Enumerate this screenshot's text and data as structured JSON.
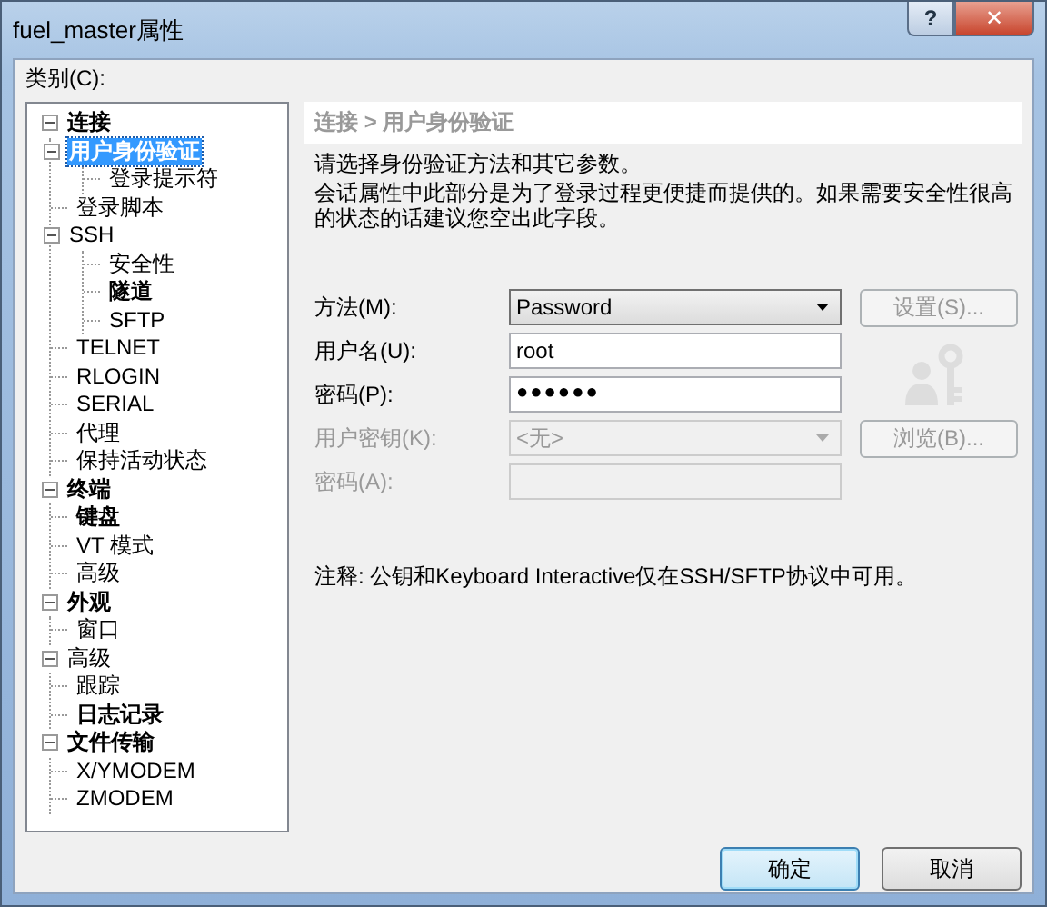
{
  "window": {
    "title": "fuel_master属性",
    "controls": [
      {
        "kind": "help",
        "label": "?"
      },
      {
        "kind": "close",
        "label": "✕"
      }
    ]
  },
  "category_label": "类别(C):",
  "tree": [
    {
      "label": "连接",
      "bold": true,
      "selected": false,
      "expanded": true,
      "children": [
        {
          "label": "用户身份验证",
          "bold": true,
          "selected": true,
          "expanded": true,
          "children": [
            {
              "label": "登录提示符",
              "bold": false,
              "selected": false
            }
          ]
        },
        {
          "label": "登录脚本",
          "bold": false,
          "selected": false
        },
        {
          "label": "SSH",
          "bold": false,
          "selected": false,
          "expanded": true,
          "children": [
            {
              "label": "安全性",
              "bold": false,
              "selected": false
            },
            {
              "label": "隧道",
              "bold": true,
              "selected": false
            },
            {
              "label": "SFTP",
              "bold": false,
              "selected": false
            }
          ]
        },
        {
          "label": "TELNET",
          "bold": false,
          "selected": false
        },
        {
          "label": "RLOGIN",
          "bold": false,
          "selected": false
        },
        {
          "label": "SERIAL",
          "bold": false,
          "selected": false
        },
        {
          "label": "代理",
          "bold": false,
          "selected": false
        },
        {
          "label": "保持活动状态",
          "bold": false,
          "selected": false
        }
      ]
    },
    {
      "label": "终端",
      "bold": true,
      "selected": false,
      "expanded": true,
      "children": [
        {
          "label": "键盘",
          "bold": true,
          "selected": false
        },
        {
          "label": "VT 模式",
          "bold": false,
          "selected": false
        },
        {
          "label": "高级",
          "bold": false,
          "selected": false
        }
      ]
    },
    {
      "label": "外观",
      "bold": true,
      "selected": false,
      "expanded": true,
      "children": [
        {
          "label": "窗口",
          "bold": false,
          "selected": false
        }
      ]
    },
    {
      "label": "高级",
      "bold": false,
      "selected": false,
      "expanded": true,
      "children": [
        {
          "label": "跟踪",
          "bold": false,
          "selected": false
        },
        {
          "label": "日志记录",
          "bold": true,
          "selected": false
        }
      ]
    },
    {
      "label": "文件传输",
      "bold": true,
      "selected": false,
      "expanded": true,
      "children": [
        {
          "label": "X/YMODEM",
          "bold": false,
          "selected": false
        },
        {
          "label": "ZMODEM",
          "bold": false,
          "selected": false
        }
      ]
    }
  ],
  "header": "连接 > 用户身份验证",
  "intro": [
    "请选择身份验证方法和其它参数。",
    "会话属性中此部分是为了登录过程更便捷而提供的。如果需要安全性很高的状态的话建议您空出此字段。"
  ],
  "form": [
    {
      "label": "方法(M):",
      "kind": "select",
      "value": "Password",
      "disabled": false,
      "button": {
        "label": "设置(S)...",
        "disabled": true
      }
    },
    {
      "label": "用户名(U):",
      "kind": "input",
      "value": "root",
      "disabled": false
    },
    {
      "label": "密码(P):",
      "kind": "password",
      "value": "●●●●●●",
      "disabled": false
    },
    {
      "label": "用户密钥(K):",
      "kind": "select",
      "value": "<无>",
      "disabled": true,
      "button": {
        "label": "浏览(B)...",
        "disabled": true
      }
    },
    {
      "label": "密码(A):",
      "kind": "input",
      "disabled": true
    }
  ],
  "note": "注释: 公钥和Keyboard Interactive仅在SSH/SFTP协议中可用。",
  "buttons": [
    {
      "label": "确定",
      "default": true
    },
    {
      "label": "取消",
      "default": false
    }
  ]
}
